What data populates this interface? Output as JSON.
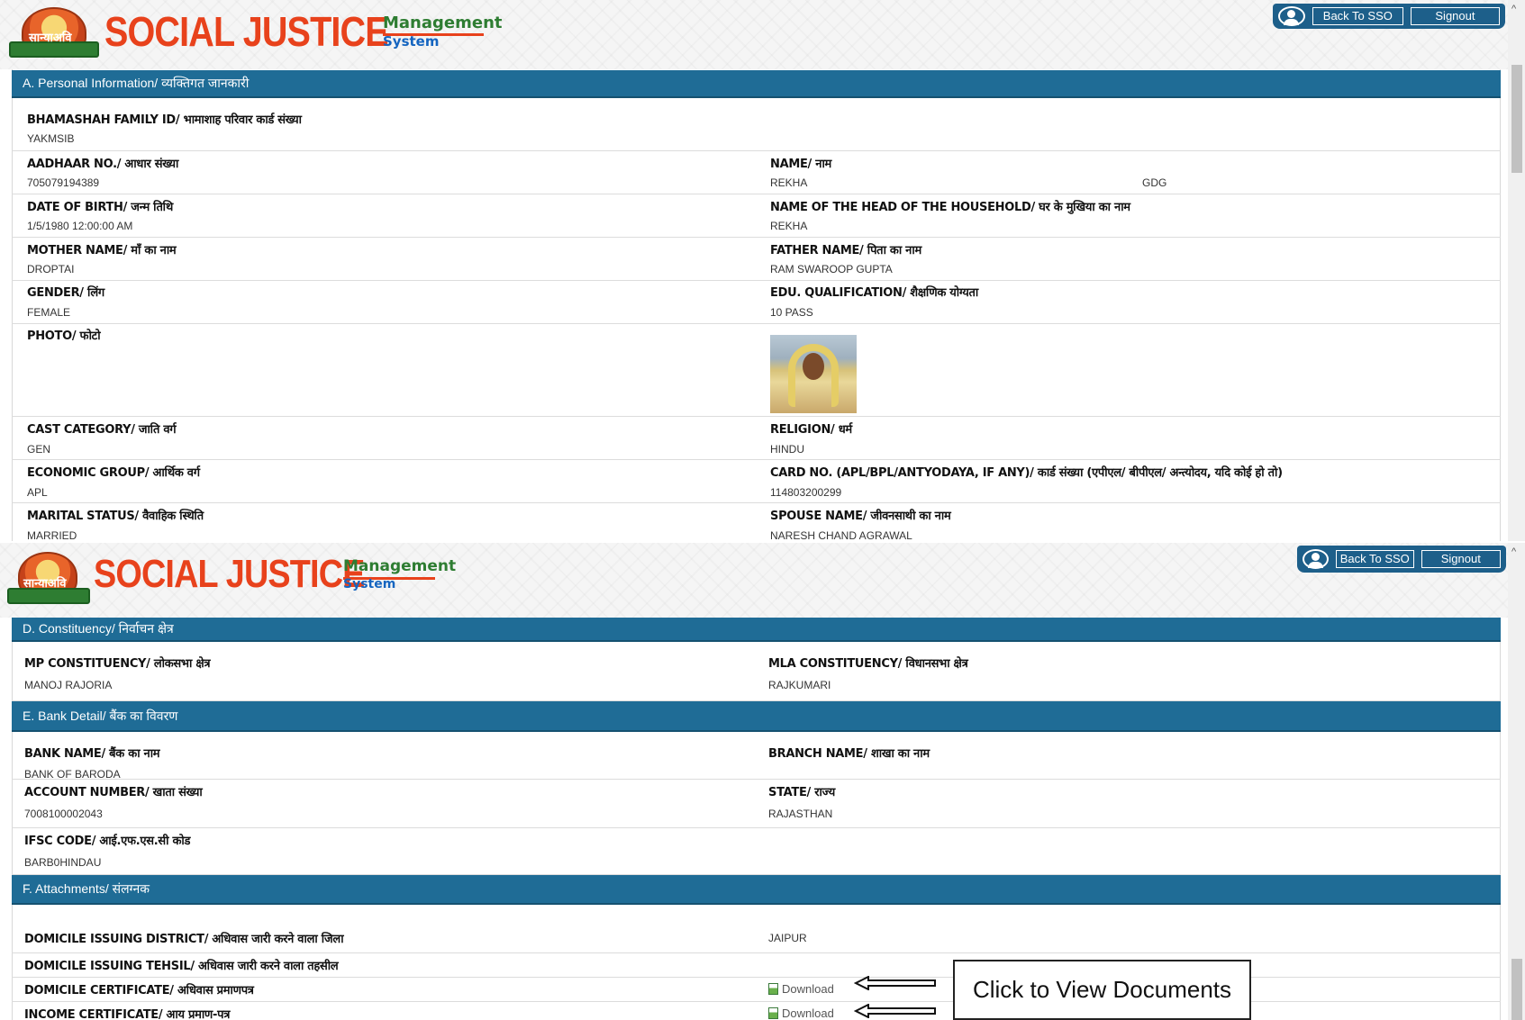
{
  "header": {
    "logo_text": "सान्याअवि",
    "brand_title": "SOCIAL JUSTICE",
    "brand_sub1": "Management",
    "brand_sub2": "System",
    "back_to_sso": "Back To SSO",
    "signout": "Signout"
  },
  "section_a": {
    "title": "A. Personal Information/ व्यक्तिगत जानकारी",
    "bhamashah_label": "BHAMASHAH FAMILY ID/ भामाशाह परिवार कार्ड संख्या",
    "bhamashah_value": "YAKMSIB",
    "aadhaar_label": "AADHAAR NO./ आधार संख्या",
    "aadhaar_value": "705079194389",
    "name_label": "NAME/ नाम",
    "name_value": "REKHA",
    "name_extra": "GDG",
    "dob_label": "DATE OF BIRTH/ जन्म तिथि",
    "dob_value": "1/5/1980 12:00:00 AM",
    "head_label": "NAME OF THE HEAD OF THE HOUSEHOLD/ घर के मुखिया का नाम",
    "head_value": "REKHA",
    "mother_label": "MOTHER NAME/ माँ का नाम",
    "mother_value": "DROPTAI",
    "father_label": "FATHER NAME/ पिता का नाम",
    "father_value": "RAM SWAROOP GUPTA",
    "gender_label": "GENDER/ लिंग",
    "gender_value": "FEMALE",
    "edu_label": "EDU. QUALIFICATION/ शैक्षणिक योग्यता",
    "edu_value": "10 PASS",
    "photo_label": "PHOTO/ फोटो",
    "cast_label": "CAST CATEGORY/ जाति वर्ग",
    "cast_value": "GEN",
    "religion_label": "RELIGION/ धर्म",
    "religion_value": "HINDU",
    "econ_label": "ECONOMIC GROUP/ आर्थिक वर्ग",
    "econ_value": "APL",
    "card_label": "CARD NO. (APL/BPL/ANTYODAYA, IF ANY)/ कार्ड संख्या (एपीएल/ बीपीएल/ अन्त्योदय, यदि कोई हो तो)",
    "card_value": "114803200299",
    "marital_label": "MARITAL STATUS/ वैवाहिक स्थिति",
    "marital_value": "MARRIED",
    "spouse_label": "SPOUSE NAME/ जीवनसाथी का नाम",
    "spouse_value": "NARESH CHAND AGRAWAL"
  },
  "section_d": {
    "title": "D. Constituency/ निर्वाचन क्षेत्र",
    "mp_label": "MP CONSTITUENCY/ लोकसभा क्षेत्र",
    "mp_value": "MANOJ RAJORIA",
    "mla_label": "MLA CONSTITUENCY/ विधानसभा क्षेत्र",
    "mla_value": "RAJKUMARI"
  },
  "section_e": {
    "title": "E. Bank Detail/ बैंक का विवरण",
    "bank_label": "BANK NAME/ बैंक का नाम",
    "bank_value": "BANK OF BARODA",
    "branch_label": "BRANCH NAME/ शाखा का नाम",
    "account_label": "ACCOUNT NUMBER/ खाता संख्या",
    "account_value": "7008100002043",
    "state_label": "STATE/ राज्य",
    "state_value": "RAJASTHAN",
    "ifsc_label": "IFSC CODE/ आई.एफ.एस.सी कोड",
    "ifsc_value": "BARB0HINDAU"
  },
  "section_f": {
    "title": "F. Attachments/ संलग्नक",
    "dom_district_label": "DOMICILE ISSUING DISTRICT/ अधिवास जारी करने वाला जिला",
    "dom_district_value": "JAIPUR",
    "dom_tehsil_label": "DOMICILE ISSUING TEHSIL/ अधिवास जारी करने वाला तहसील",
    "dom_cert_label": "DOMICILE CERTIFICATE/ अधिवास प्रमाणपत्र",
    "income_cert_label": "INCOME CERTIFICATE/ आय प्रमाण-पत्र",
    "download_label": "Download"
  },
  "callout": {
    "text": "Click to View Documents"
  },
  "colors": {
    "section_header": "#1f6c96",
    "brand_red": "#e8421c",
    "brand_green": "#2e7d32"
  },
  "icons": [
    "user-icon",
    "download-icon",
    "arrow-left-icon",
    "scroll-up-icon"
  ]
}
